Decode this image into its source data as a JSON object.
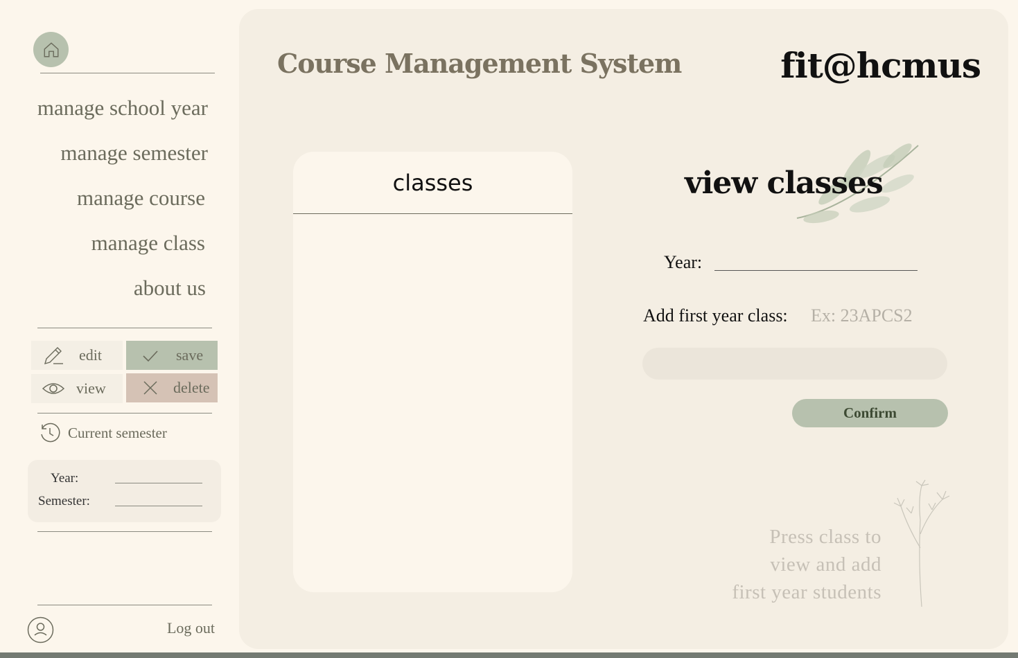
{
  "sidebar": {
    "nav": [
      {
        "label": "manage school year"
      },
      {
        "label": "manage semester"
      },
      {
        "label": "manage course"
      },
      {
        "label": "manage class"
      },
      {
        "label": "about us"
      }
    ],
    "actions": {
      "edit": "edit",
      "save": "save",
      "view": "view",
      "delete": "delete"
    },
    "current_semester": {
      "label": "Current semester",
      "year_label": "Year:",
      "semester_label": "Semester:"
    },
    "logout": "Log out"
  },
  "header": {
    "title": "Course Management System",
    "brand": "fit@hcmus"
  },
  "classes_panel": {
    "heading": "classes",
    "items": []
  },
  "form": {
    "title": "view classes",
    "year_label": "Year:",
    "add_label": "Add first year class:",
    "add_placeholder": "Ex: 23APCS2",
    "confirm": "Confirm"
  },
  "hint": {
    "line1": "Press class to",
    "line2": "view and add",
    "line3": "first year students"
  },
  "colors": {
    "background": "#fcf6ec",
    "panel": "#f4eee3",
    "sage": "#b7c1ae",
    "rose": "#d5c2b5",
    "text": "#6b6b5c"
  },
  "icons": [
    "home-icon",
    "pencil-icon",
    "check-icon",
    "eye-icon",
    "x-icon",
    "history-icon",
    "user-icon"
  ]
}
